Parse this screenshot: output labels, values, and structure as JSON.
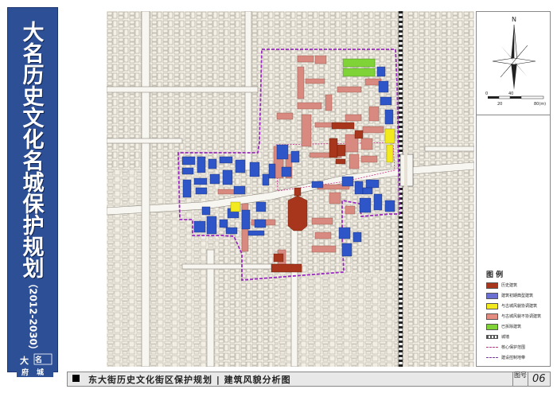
{
  "side_title": {
    "chars": [
      "大",
      "名",
      "历",
      "史",
      "文",
      "化",
      "名",
      "城",
      "保",
      "护",
      "规",
      "划"
    ],
    "years": "（2012-2030）",
    "seal_text": "大名府城"
  },
  "bottom_bar": {
    "caption": "东大街历史文化街区保护规划 | 建筑风貌分析图",
    "fig_label": "图号",
    "fig_number": "06"
  },
  "compass": {
    "north_label": "N"
  },
  "scale_bar": {
    "labels": [
      "0",
      "20",
      "40",
      "80(m)"
    ]
  },
  "legend": {
    "title": "图 例",
    "items": [
      {
        "label": "历史建筑",
        "color": "#a8361c",
        "style": "fill"
      },
      {
        "label": "建筑初期典型建筑",
        "color": "#6b6fd2",
        "style": "fill"
      },
      {
        "label": "与古城风貌协调建筑",
        "color": "#f2ea1f",
        "style": "fill"
      },
      {
        "label": "与古城风貌不协调建筑",
        "color": "#e58c80",
        "style": "fill"
      },
      {
        "label": "已拆除建筑",
        "color": "#7fd337",
        "style": "fill"
      },
      {
        "label": "城墙",
        "color": "#555555",
        "style": "wall"
      },
      {
        "label": "核心保护范围",
        "color": "#cc2c8a",
        "style": "dash"
      },
      {
        "label": "建设控制地带",
        "color": "#8a2bb5",
        "style": "dash"
      }
    ]
  },
  "colors": {
    "title_bar": "#2d4f95",
    "map_bg": "#f4f0e6",
    "historic": "#a8361c",
    "typical": "#2f56c8",
    "coordinated": "#f2ea1f",
    "uncoordinated": "#d98a80",
    "demolished": "#7fd337",
    "boundary": "#9b2bc0"
  }
}
